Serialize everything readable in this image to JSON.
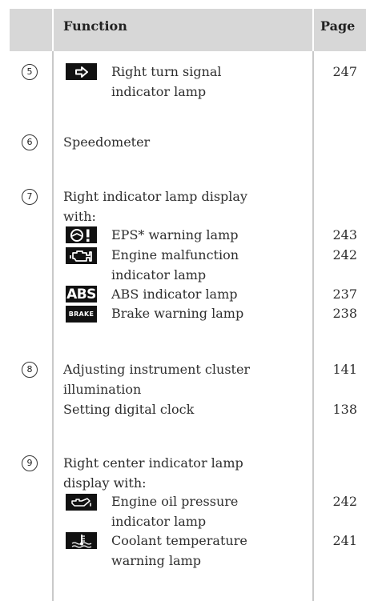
{
  "header": {
    "function_label": "Function",
    "page_label": "Page"
  },
  "rows": {
    "r5": {
      "num": "5",
      "line1": "Right turn signal",
      "line2": "indicator lamp",
      "page": "247",
      "icon": "right-arrow-icon"
    },
    "r6": {
      "num": "6",
      "line1": "Speedometer"
    },
    "r7": {
      "num": "7",
      "line1": "Right indicator lamp display",
      "line2": "with:",
      "items": [
        {
          "label": "EPS* warning lamp",
          "page": "243",
          "icon": "eps-steering-icon"
        },
        {
          "label": "Engine malfunction",
          "label2": "indicator lamp",
          "page": "242",
          "icon": "engine-icon"
        },
        {
          "label": "ABS indicator lamp",
          "page": "237",
          "icon": "abs-icon",
          "icon_text": "ABS"
        },
        {
          "label": "Brake warning lamp",
          "page": "238",
          "icon": "brake-icon",
          "icon_text": "BRAKE"
        }
      ]
    },
    "r8": {
      "num": "8",
      "line1": "Adjusting instrument cluster",
      "line2": "illumination",
      "page1": "141",
      "line3": "Setting digital clock",
      "page2": "138"
    },
    "r9": {
      "num": "9",
      "line1": "Right center indicator lamp",
      "line2": "display with:",
      "items": [
        {
          "label": "Engine oil pressure",
          "label2": "indicator lamp",
          "page": "242",
          "icon": "oil-can-icon"
        },
        {
          "label": "Coolant temperature",
          "label2": "warning lamp",
          "page": "241",
          "icon": "coolant-temp-icon"
        }
      ]
    }
  }
}
